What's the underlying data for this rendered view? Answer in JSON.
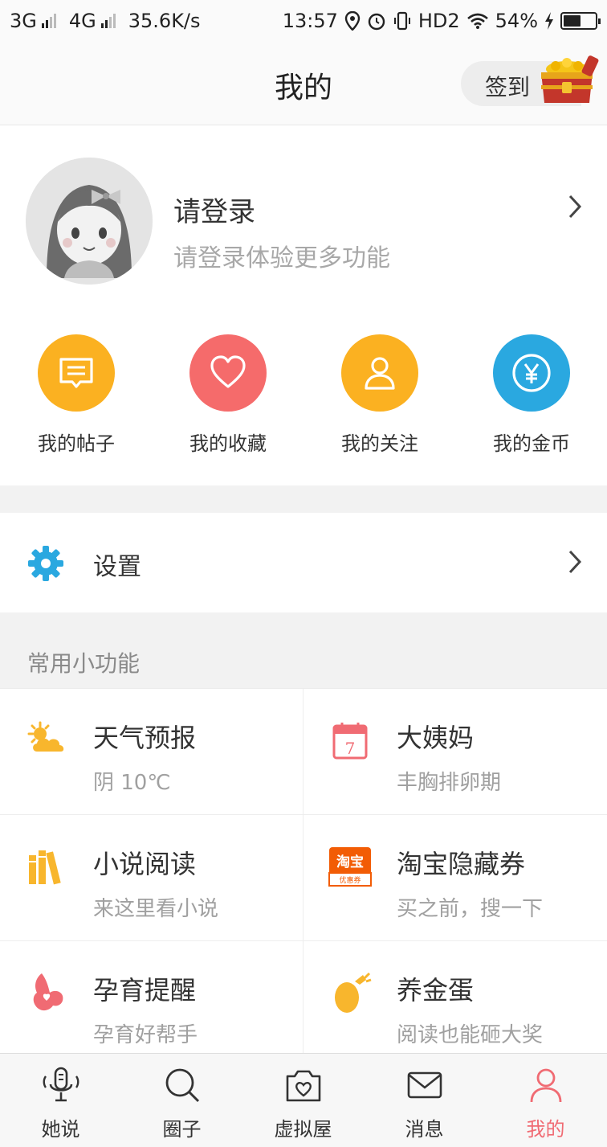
{
  "status_bar": {
    "net1": "3G",
    "net2": "4G",
    "speed": "35.6K/s",
    "time": "13:57",
    "hd": "HD2",
    "battery_pct": "54%",
    "battery_level": 0.54
  },
  "header": {
    "title": "我的",
    "checkin_label": "签到"
  },
  "profile": {
    "name": "请登录",
    "subtitle": "请登录体验更多功能"
  },
  "quick_actions": [
    {
      "label": "我的帖子",
      "icon": "message-icon",
      "color": "#fbb121"
    },
    {
      "label": "我的收藏",
      "icon": "heart-icon",
      "color": "#f56b6b"
    },
    {
      "label": "我的关注",
      "icon": "person-icon",
      "color": "#fbb121"
    },
    {
      "label": "我的金币",
      "icon": "yen-coin-icon",
      "color": "#2aa8e0"
    }
  ],
  "settings": {
    "label": "设置"
  },
  "section_title": "常用小功能",
  "features": [
    {
      "title": "天气预报",
      "subtitle": "阴 10℃",
      "icon": "weather-icon"
    },
    {
      "title": "大姨妈",
      "subtitle": "丰胸排卵期",
      "icon": "calendar-icon",
      "icon_text": "7"
    },
    {
      "title": "小说阅读",
      "subtitle": "来这里看小说",
      "icon": "books-icon"
    },
    {
      "title": "淘宝隐藏券",
      "subtitle": "买之前，搜一下",
      "icon": "taobao-icon",
      "icon_text": "淘宝",
      "icon_subtext": "优惠券"
    },
    {
      "title": "孕育提醒",
      "subtitle": "孕育好帮手",
      "icon": "pregnancy-icon"
    },
    {
      "title": "养金蛋",
      "subtitle": "阅读也能砸大奖",
      "icon": "golden-egg-icon"
    }
  ],
  "tabs": [
    {
      "label": "她说",
      "icon": "microphone-icon",
      "active": false
    },
    {
      "label": "圈子",
      "icon": "search-icon",
      "active": false
    },
    {
      "label": "虚拟屋",
      "icon": "camera-heart-icon",
      "active": false
    },
    {
      "label": "消息",
      "icon": "mail-icon",
      "active": false
    },
    {
      "label": "我的",
      "icon": "person-icon",
      "active": true
    }
  ],
  "colors": {
    "accent": "#f06b73",
    "yellow": "#fbb121",
    "red": "#f56b6b",
    "blue": "#2aa8e0"
  }
}
